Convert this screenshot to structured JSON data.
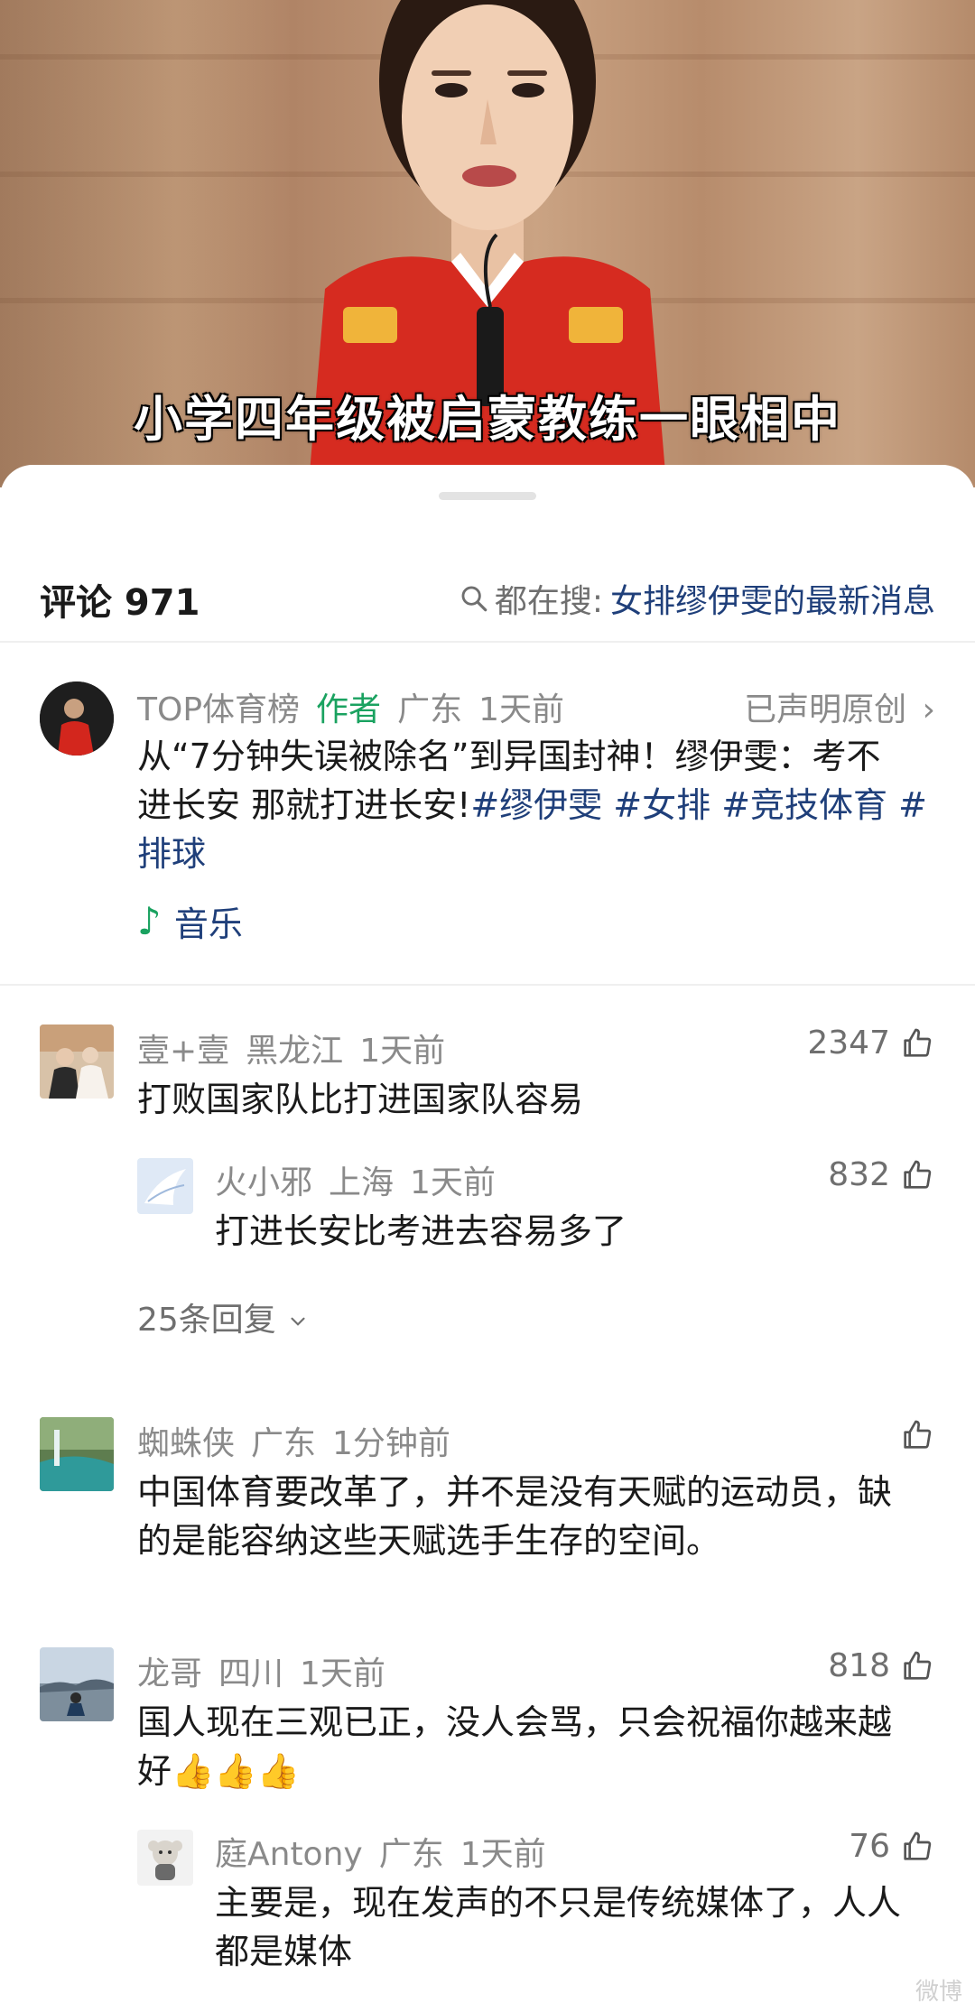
{
  "video": {
    "subtitle": "小学四年级被启蒙教练一眼相中"
  },
  "comments_header": {
    "title": "评论 971",
    "search_prefix": "都在搜:",
    "search_query": "女排缪伊雯的最新消息"
  },
  "post": {
    "author": "TOP体育榜",
    "author_tag": "作者",
    "location": "广东",
    "time": "1天前",
    "original_label": "已声明原创",
    "text_line1": "从“7分钟失误被除名”到异国封神！缪伊雯：考不",
    "text_line2_plain": "进长安 那就打进长安!",
    "tag1": "#缪伊雯",
    "tag2": "#女排",
    "tag3": "#竞技体育",
    "tag4_start": "#",
    "tag4_end": "排球",
    "music_label": "音乐"
  },
  "comments": [
    {
      "user": "壹+壹",
      "location": "黑龙江",
      "time": "1天前",
      "likes": "2347",
      "text": "打败国家队比打进国家队容易",
      "reply": {
        "user": "火小邪",
        "location": "上海",
        "time": "1天前",
        "likes": "832",
        "text": "打进长安比考进去容易多了"
      },
      "more_replies": "25条回复"
    },
    {
      "user": "蜘蛛侠",
      "location": "广东",
      "time": "1分钟前",
      "likes": "",
      "text_line1": "中国体育要改革了，并不是没有天赋的运动员，缺",
      "text_line2": "的是能容纳这些天赋选手生存的空间。"
    },
    {
      "user": "龙哥",
      "location": "四川",
      "time": "1天前",
      "likes": "818",
      "text_line1": "国人现在三观已正，没人会骂，只会祝福你越来越",
      "text_line2": "好👍👍👍",
      "reply": {
        "user": "庭Antony",
        "location": "广东",
        "time": "1天前",
        "likes": "76",
        "text_line1": "主要是，现在发声的不只是传统媒体了，人人",
        "text_line2": "都是媒体"
      }
    }
  ],
  "watermark": "微博"
}
